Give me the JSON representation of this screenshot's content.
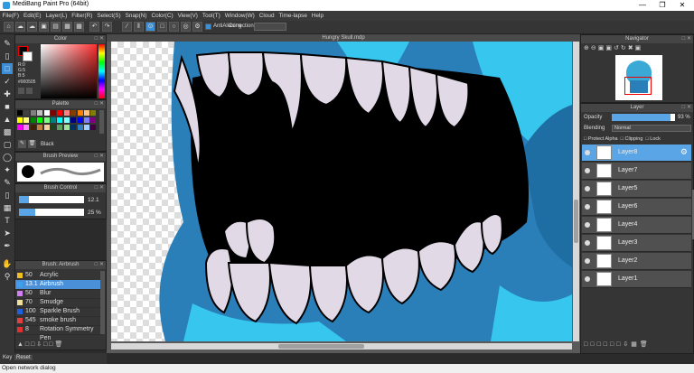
{
  "app": {
    "title": "MediBang Paint Pro (64bit)"
  },
  "menu": [
    "File(F)",
    "Edit(E)",
    "Layer(L)",
    "Filter(R)",
    "Select(S)",
    "Snap(N)",
    "Color(C)",
    "View(V)",
    "Tool(T)",
    "Window(W)",
    "Cloud",
    "Time-lapse",
    "Help"
  ],
  "toolbar": {
    "antialias_label": "AntiAliasing",
    "correction_label": "Correction"
  },
  "document": {
    "title": "Hungry Skull.mdp"
  },
  "color_panel": {
    "title": "Color",
    "r_label": "R:0",
    "g_label": "G:5",
    "b_label": "B:5",
    "hex": "#000505",
    "primary_color": "#000505",
    "secondary_color": "#ffffff"
  },
  "palette_panel": {
    "title": "Palette",
    "selected_name": "Black",
    "colors": [
      "#000000",
      "#404040",
      "#808080",
      "#c0c0c0",
      "#ffffff",
      "#800000",
      "#ff0000",
      "#ff8080",
      "#804000",
      "#ff8000",
      "#ffc080",
      "#808000",
      "#ffff00",
      "#ffff80",
      "#008000",
      "#00ff00",
      "#80ff80",
      "#008080",
      "#00ffff",
      "#80ffff",
      "#000080",
      "#0000ff",
      "#8080ff",
      "#800080",
      "#ff00ff",
      "#ff80ff",
      "#402000",
      "#c08040",
      "#f0d0a0",
      "#204020",
      "#60a060",
      "#a0e0a0",
      "#003060",
      "#3080c0",
      "#a0d0ff",
      "#400040"
    ]
  },
  "brush_preview": {
    "title": "Brush Preview"
  },
  "brush_control": {
    "title": "Brush Control",
    "size_value": "12.1",
    "opacity_value": "25 %",
    "size_fraction": 0.15,
    "opacity_fraction": 0.25
  },
  "brush_list": {
    "title": "Brush: Airbrush",
    "items": [
      {
        "size": "50",
        "name": "Acrylic",
        "color": "#f0c020"
      },
      {
        "size": "13.1",
        "name": "Airbrush",
        "color": "#40a0f0",
        "selected": true
      },
      {
        "size": "50",
        "name": "Blur",
        "color": "#d080f0"
      },
      {
        "size": "70",
        "name": "Smudge",
        "color": "#f0e0a0"
      },
      {
        "size": "100",
        "name": "Sparkle Brush",
        "color": "#2060e0"
      },
      {
        "size": "545",
        "name": "smoke brush",
        "color": "#e04040"
      },
      {
        "size": "8",
        "name": "Rotation Symmetry Pen",
        "color": "#e03030"
      }
    ]
  },
  "navigator": {
    "title": "Navigator"
  },
  "layer_panel": {
    "title": "Layer",
    "opacity_label": "Opacity",
    "opacity_value": "93 %",
    "opacity_fraction": 0.93,
    "blending_label": "Blending",
    "blending_value": "Normal",
    "protect_alpha": "Protect Alpha",
    "clipping": "Clipping",
    "lock": "Lock",
    "layers": [
      {
        "name": "Layer8",
        "selected": true
      },
      {
        "name": "Layer7"
      },
      {
        "name": "Layer5"
      },
      {
        "name": "Layer6"
      },
      {
        "name": "Layer4"
      },
      {
        "name": "Layer3"
      },
      {
        "name": "Layer2"
      },
      {
        "name": "Layer1"
      }
    ]
  },
  "bottom_left": {
    "key_label": "Key",
    "reset_label": "Reset"
  },
  "status": {
    "text": "Open network dialog"
  }
}
